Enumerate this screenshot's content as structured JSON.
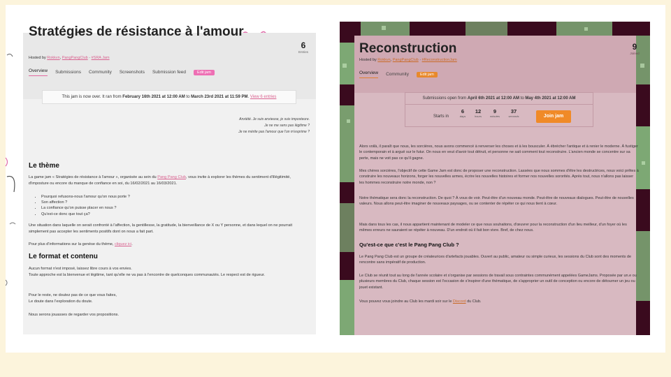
{
  "left": {
    "title": "Stratégies de résistance à l'amour",
    "entries_count": "6",
    "entries_label": "Entries",
    "hosted_prefix": "Hosted by ",
    "hosted_user": "Rokkvn",
    "hosted_sep1": ", ",
    "hosted_club": "PangPangClub",
    "hosted_sep2": " · ",
    "hosted_tag": "#SRA Jam",
    "tabs": [
      "Overview",
      "Submissions",
      "Community",
      "Screenshots",
      "Submission feed"
    ],
    "edit_label": "Edit jam",
    "notice_prefix": "This jam is now over. It ran from ",
    "notice_start": "February 16th 2021 at 12:00 AM",
    "notice_mid": " to ",
    "notice_end": "March 23rd 2021 at 11:59 PM",
    "notice_sep": ". ",
    "notice_link": "View 6 entries",
    "quote": [
      "Anxiété. Je suis anxieuse, je suis imposteure.",
      "Je ne me sens pas légitime ?",
      "Je ne mérite pas l'amour que l'on m'exprime ?"
    ],
    "h_theme": "Le thème",
    "p1_a": "La game jam « Stratégies de résistance à l'amour », organisée au sein du ",
    "p1_link": "Pang Pang Club",
    "p1_b": ", vous invite à explorer les thèmes du sentiment d'illégitimité, d'imposture ou encore du manque de confiance en soi, du 16/02/2021 au 16/03/2021.",
    "bullets": [
      "Pourquoi refusons-nous l'amour qu'on nous porte ?",
      "Son affection ?",
      "La confiance qu'on puisse placer en nous ?",
      "Qu'est-ce donc que tout ça?"
    ],
    "p2": "Une situation dans laquelle on serait confronté à l'affection, la gentillesse, la gratitude, la bienveillance de X ou Y personne, et dans lequel on ne pourrait simplement pas accepter les sentiments positifs dont on nous a fait part.",
    "p3_a": "Pour plus d'informations sur la genèse du thème, ",
    "p3_link": "cliquez ici",
    "p3_b": ".",
    "h_format": "Le format et contenu",
    "p4": [
      "Aucun format n'est imposé, laissez libre cours à vos envies.",
      "Toute approche est la bienvenue et légitime, tant qu'elle ne va pas à l'encontre de quelconques communautés. Le respect est de rigueur."
    ],
    "p5": [
      "Pour le reste, ne doutez pas de ce que vous faites,",
      "Le doute dans l'exploration du doute."
    ],
    "p6": "Nous serons jouasses de regarder vos propositions."
  },
  "right": {
    "title": "Reconstruction",
    "joined_count": "9",
    "joined_label": "Joined",
    "hosted_prefix": "Hosted by ",
    "hosted_user": "Rokkvn",
    "hosted_sep1": ", ",
    "hosted_club": "PangPangClub",
    "hosted_sep2": " · ",
    "hosted_tag": "#ReconstructionJam",
    "tabs": [
      "Overview",
      "Community"
    ],
    "edit_label": "Edit jam",
    "subs_prefix": "Submissions open from ",
    "subs_start": "April 6th 2021 at 12:00 AM",
    "subs_mid": " to ",
    "subs_end": "May 4th 2021 at 12:00 AM",
    "starts_label": "Starts in",
    "countdown": [
      {
        "n": "6",
        "u": "days"
      },
      {
        "n": "12",
        "u": "hours"
      },
      {
        "n": "9",
        "u": "minutes"
      },
      {
        "n": "37",
        "u": "seconds"
      }
    ],
    "join_label": "Join jam",
    "p1": "Alors voilà, il paraît que nous, les sorcières, nous avons commencé à renverser les choses et à les bousculer. À ébrécher l'antique et à renier le moderne. À fustiger le contemporain et à arguë sur le futur. On nous en veut d'avoir tout détruit, et personne ne sait comment tout reconstruire. L'ancien monde se concentre sur sa perte, mais ne voit pas ce qu'il gagne.",
    "p2": "Mes chères sorcières, l'objectif de cette Game Jam est donc de proposer une reconstruction. Lassées que nous sommes d'être les destructrices, nous voici prêtes à construire les nouveaux horizons, forger les nouvelles armes, écrire les nouvelles histoires et former nos nouvelles sororités. Après tout, nous n'allons pas laisser les hommes reconstruire notre monde, non ?",
    "p3": "Notre thématique sera donc la reconstruction. De quoi ? À vous de voir. Peut-être d'un nouveau monde. Peut-être de nouveaux dialogues. Peut-être de nouvelles valeurs. Nous allons peut-être imaginer de nouveaux paysages, ou se contenter de répéter ce qui nous tient à cœur.",
    "p4": "Mais dans tous les cas, il nous appartient maintenant de modeler ce que nous souhaitons, d'œuvrer pour la reconstruction d'un lieu meilleur, d'un foyer où les mêmes erreurs ne sauraient se répéter à nouveau. D'un endroit où il fait bon vivre. Bref, de chez nous.",
    "h_club": "Qu'est-ce que c'est le Pang Pang Club ?",
    "p5": "Le Pang Pang Club est un groupe de créateurices d'artefacts jouables. Ouvert au public, amateur ou simple curieux, les sessions du Club sont des moments de rencontre sans impératif de production.",
    "p6": "Le Club se réunit tout au long de l'année scolaire et s'organise par sessions de travail sous contraintes communément appelées GameJams. Proposée par un.e ou plusieurs membres du Club, chaque session est l'occasion de s'inspirer d'une thématique, de s'approprier un outil de conception ou encore de détourner un jeu ou jouet existant.",
    "p7_a": "Vous pouvez vous joindre au Club les mardi soir sur le ",
    "p7_link": "Discord",
    "p7_b": " du Club."
  },
  "colors": {
    "page_bg": "#fcf4dc",
    "left_accent": "#ee6fb4",
    "right_accent": "#f08a28",
    "right_card": "#d8b9c1",
    "right_bg_dark": "#3a0a1e",
    "right_bg_green": "#8fcf8a"
  }
}
